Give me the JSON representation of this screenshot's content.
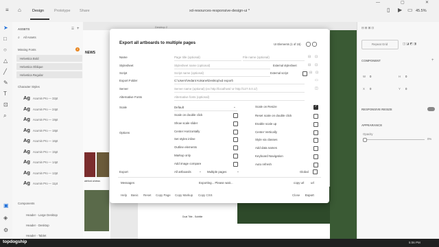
{
  "titlebar": {
    "tabs": [
      "Design",
      "Prototype",
      "Share"
    ],
    "document_title": "xd-resources-responsive-design-ui *",
    "zoom": "45.5%"
  },
  "assets": {
    "header": "ASSETS",
    "search_placeholder": "All Assets",
    "missing_fonts": "Missing Fonts",
    "missing_count": "2",
    "fonts": [
      "Helvetica Bold",
      "Helvetica Oblique",
      "Helvetica Regular"
    ],
    "char_styles_header": "Character Styles",
    "char_styles": [
      {
        "glyph": "Ag",
        "label": "Acumin Pro — 32pt"
      },
      {
        "glyph": "Ag",
        "label": "Acumin Pro — 24pt"
      },
      {
        "glyph": "Ag",
        "label": "Acumin Pro — 19pt"
      },
      {
        "glyph": "Ag",
        "label": "Acumin Pro — 18pt"
      },
      {
        "glyph": "Ag",
        "label": "Acumin Pro — 16pt"
      },
      {
        "glyph": "Ag",
        "label": "Acumin Pro — 15pt"
      },
      {
        "glyph": "Ag",
        "label": "Acumin Pro — 14pt"
      },
      {
        "glyph": "Ag",
        "label": "Acumin Pro — 12pt"
      },
      {
        "glyph": "Ag",
        "label": "Acumin Pro — 11pt"
      }
    ],
    "components_header": "Components",
    "components": [
      "Header - Large Desktop",
      "Header - Desktop",
      "Header - Tablet"
    ]
  },
  "canvas": {
    "artboard_label": "Desktop 2",
    "news_label": "NEWS",
    "caption": "ateford a/news",
    "doc_title_label": "Dual Title - Subtitle"
  },
  "right_panel": {
    "repeat_grid": "Repeat Grid",
    "component": "COMPONENT",
    "w_label": "W",
    "w_value": "0",
    "h_label": "H",
    "h_value": "0",
    "x_label": "X",
    "x_value": "0",
    "y_label": "Y",
    "y_value": "0",
    "responsive_resize": "RESPONSIVE RESIZE",
    "appearance": "APPEARANCE",
    "opacity_label": "Opacity",
    "opacity_value": "0%"
  },
  "dialog": {
    "title": "Export all artboards to multiple pages",
    "counter": "UI Elements (1 of 15)",
    "fields": {
      "name_label": "Name",
      "name_placeholder": "Page title (optional)",
      "filename_placeholder": "File name (optional)",
      "stylesheet_label": "Stylesheet",
      "stylesheet_placeholder": "Stylesheet name (optional)",
      "external_stylesheet": "External stylesheet",
      "script_label": "Script",
      "script_placeholder": "Script name (optional)",
      "external_script": "External script",
      "export_folder_label": "Export Folder",
      "export_folder_value": "C:\\Users\\Vedant Kokane\\Desktop\\xd export\\",
      "server_label": "Server",
      "server_placeholder": "Server name (optional) (ex http://localhost/ or http://127.0.0.1/)",
      "alt_fonts_label": "Alternative Fonts",
      "alt_fonts_placeholder": "Alternative fonts (optional)"
    },
    "scale_label": "Scale",
    "scale_value": "Default",
    "options_label": "Options",
    "options_left": [
      {
        "label": "Scale on double click",
        "checked": false
      },
      {
        "label": "Show scale slider",
        "checked": false
      },
      {
        "label": "Center Horizontally",
        "checked": false
      },
      {
        "label": "Set styles inline",
        "checked": false
      },
      {
        "label": "Outline elements",
        "checked": false
      },
      {
        "label": "Markup only",
        "checked": false
      },
      {
        "label": "Add image compare",
        "checked": false
      }
    ],
    "options_right": [
      {
        "label": "Scale on Resize",
        "checked": true
      },
      {
        "label": "Reset scale on double click",
        "checked": false
      },
      {
        "label": "Enable scale up",
        "checked": false
      },
      {
        "label": "Center Vertically",
        "checked": false
      },
      {
        "label": "Style via classes",
        "checked": false
      },
      {
        "label": "Add data names",
        "checked": false
      },
      {
        "label": "Keyboard Navigation",
        "checked": false
      },
      {
        "label": "Auto refresh",
        "checked": false
      }
    ],
    "export_label": "Export",
    "export_select": "All artboards",
    "pages_select": "Multiple pages",
    "global_label": "Global",
    "messages_label": "Messages",
    "messages_value": "Exporting... Please wait...",
    "copy_url": "copy url",
    "url": "url",
    "buttons": [
      "Help",
      "Basic",
      "Reset",
      "Copy Page",
      "Copy Markup",
      "Copy CSS"
    ],
    "close": "Close",
    "export_button": "Export"
  },
  "taskbar": {
    "brand": "topdogship",
    "time": "5:06 PM"
  }
}
